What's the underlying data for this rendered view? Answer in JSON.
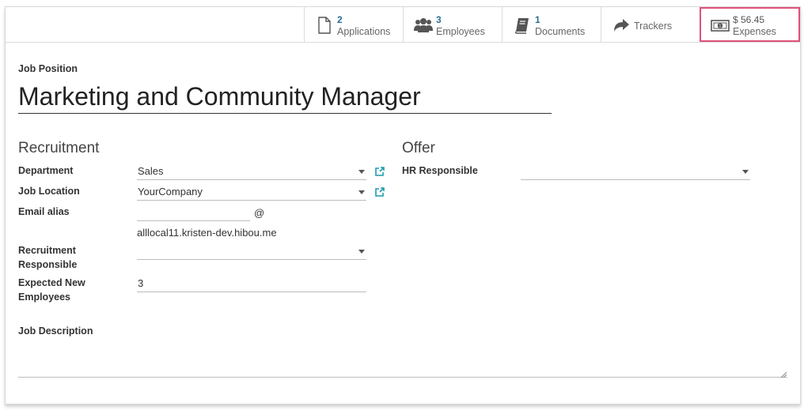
{
  "smart_buttons": {
    "applications": {
      "count": "2",
      "label": "Applications",
      "icon": "file-icon"
    },
    "employees": {
      "count": "3",
      "label": "Employees",
      "icon": "users-icon"
    },
    "documents": {
      "count": "1",
      "label": "Documents",
      "icon": "book-icon"
    },
    "trackers": {
      "label": "Trackers",
      "icon": "share-arrow-icon"
    },
    "expenses": {
      "amount": "$ 56.45",
      "label": "Expenses",
      "icon": "money-icon"
    }
  },
  "form": {
    "job_position_label": "Job Position",
    "job_position_value": "Marketing and Community Manager",
    "recruitment": {
      "heading": "Recruitment",
      "department_label": "Department",
      "department_value": "Sales",
      "job_location_label": "Job Location",
      "job_location_value": "YourCompany",
      "email_alias_label": "Email alias",
      "email_alias_value": "",
      "email_alias_at": "@",
      "email_alias_domain": "alllocal11.kristen-dev.hibou.me",
      "recruitment_responsible_label_1": "Recruitment",
      "recruitment_responsible_label_2": "Responsible",
      "recruitment_responsible_value": "",
      "expected_new_label_1": "Expected New",
      "expected_new_label_2": "Employees",
      "expected_new_value": "3"
    },
    "offer": {
      "heading": "Offer",
      "hr_responsible_label": "HR Responsible",
      "hr_responsible_value": ""
    },
    "job_description_label": "Job Description",
    "job_description_value": ""
  },
  "colors": {
    "highlight": "#e0517a",
    "link": "#2f6f8f",
    "external_link": "#1f9ab0"
  }
}
